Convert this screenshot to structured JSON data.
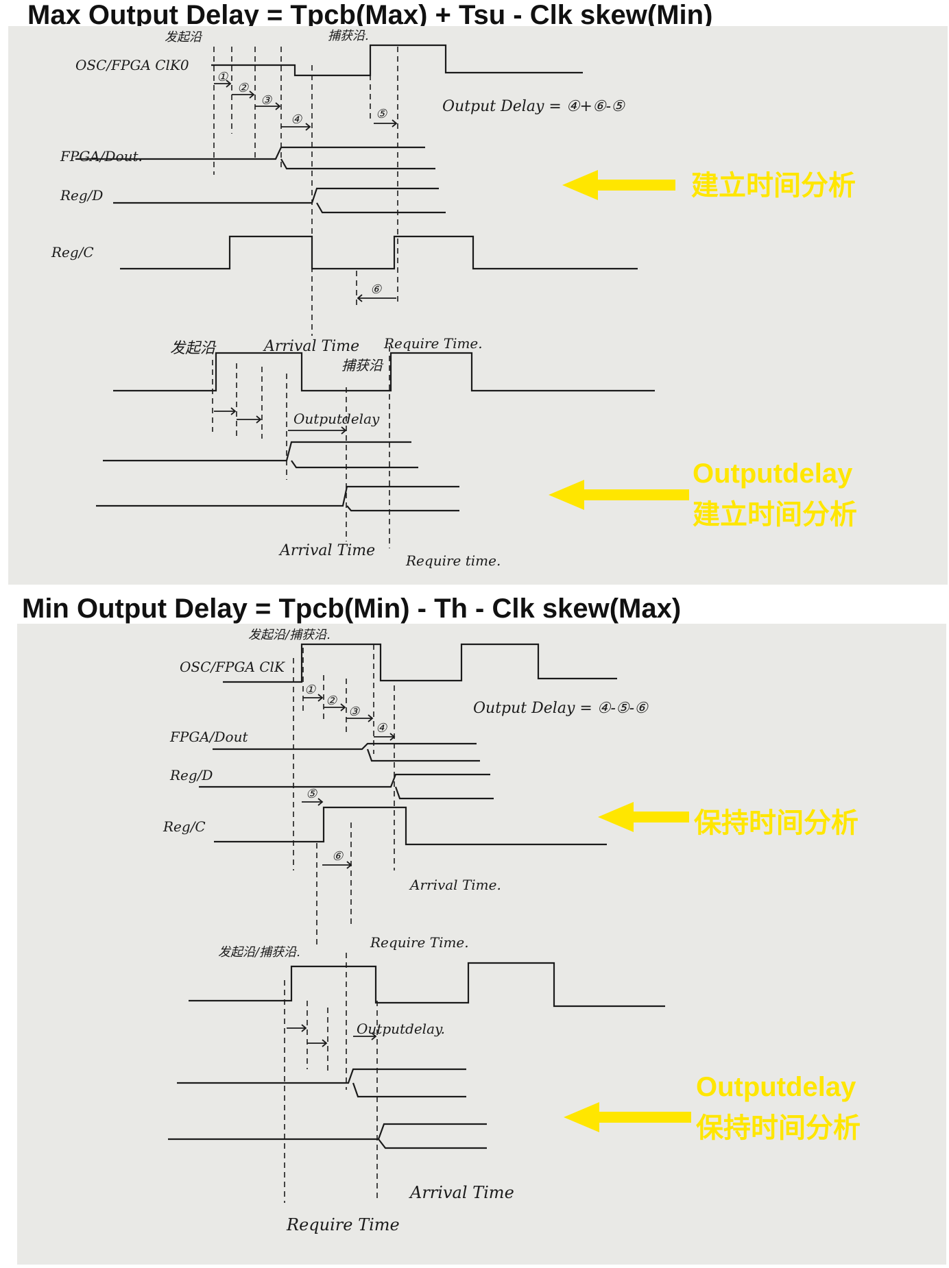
{
  "top": {
    "title": "Max Output Delay = Tpcb(Max) + Tsu - Clk skew(Min)",
    "formula": "Output Delay = ④+⑥-⑤",
    "signals": [
      "OSC/FPGA ClK0",
      "FPGA/Dout.",
      "Reg/D",
      "Reg/C"
    ],
    "launch": "发起沿",
    "capture": "捕获沿.",
    "launch2": "发起沿",
    "capture2": "捕获沿",
    "arrival": "Arrival Time",
    "require": "Require Time.",
    "arrival2": "Arrival Time",
    "require2": "Require time.",
    "outputdelay": "Outputdelay",
    "callout1": "建立时间分析",
    "callout2_line1": "Outputdelay",
    "callout2_line2": "建立时间分析",
    "markers": [
      "①",
      "②",
      "③",
      "④",
      "⑤",
      "⑥"
    ]
  },
  "bottom": {
    "title": "Min Output Delay = Tpcb(Min) - Th - Clk skew(Max)",
    "formula": "Output Delay = ④-⑤-⑥",
    "signals": [
      "OSC/FPGA ClK",
      "FPGA/Dout",
      "Reg/D",
      "Reg/C"
    ],
    "launch_capture": "发起沿/捕获沿.",
    "launch_capture2": "发起沿/捕获沿.",
    "arrival": "Arrival Time.",
    "require": "Require Time.",
    "arrival2": "Arrival Time",
    "require2": "Require Time",
    "outputdelay": "Outputdelay.",
    "callout1": "保持时间分析",
    "callout2_line1": "Outputdelay",
    "callout2_line2": "保持时间分析",
    "markers": [
      "①",
      "②",
      "③",
      "④",
      "⑤",
      "⑥"
    ]
  },
  "colors": {
    "highlight": "#ffe600",
    "paper": "#e9e9e6",
    "ink": "#1a1a1a"
  }
}
